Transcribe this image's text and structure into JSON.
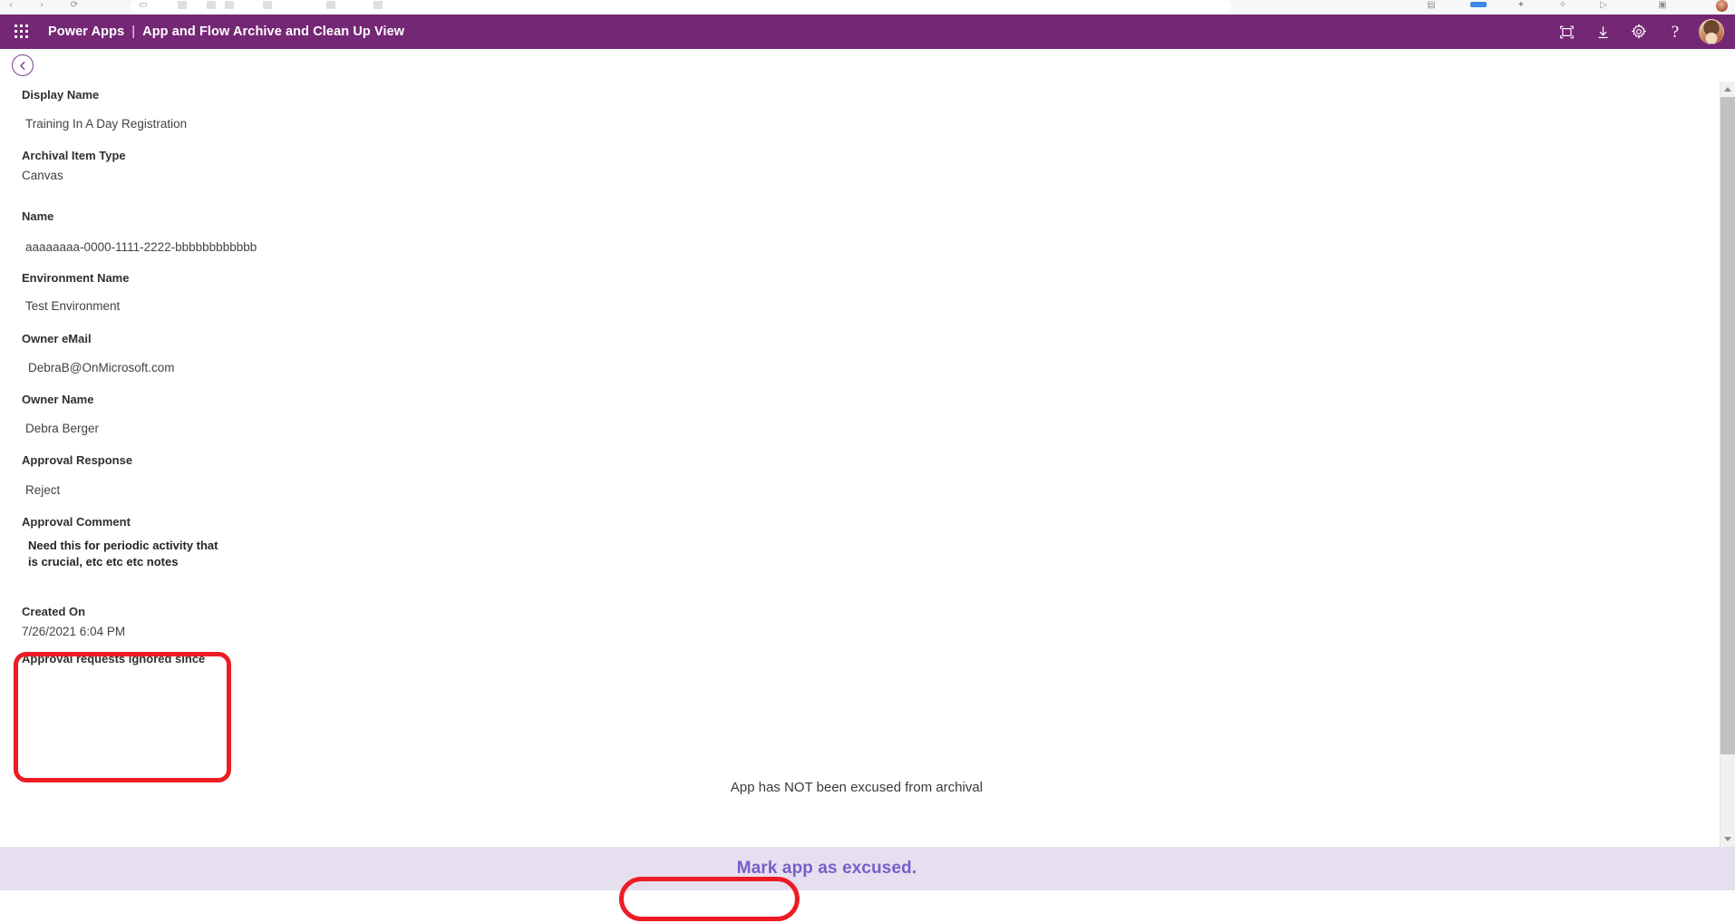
{
  "browser": {
    "url_bar_placeholder": ""
  },
  "header": {
    "waffle_icon": "app-launcher-icon",
    "brand": "Power Apps",
    "separator": "|",
    "page_title": "App and Flow Archive and Clean Up View",
    "purple": "#742774",
    "actions": [
      {
        "name": "fit-to-screen-icon",
        "tooltip": "Fit to screen"
      },
      {
        "name": "download-icon",
        "tooltip": "Download"
      },
      {
        "name": "gear-icon",
        "tooltip": "Settings"
      },
      {
        "name": "help-icon",
        "label": "?"
      }
    ],
    "avatar_name": "user-avatar"
  },
  "back_button": {
    "icon": "chevron-left-icon",
    "label": "Back"
  },
  "form": {
    "fields": [
      {
        "label": "Display Name",
        "value": "Training In A Day Registration"
      },
      {
        "label": "Archival Item Type",
        "value": "Canvas"
      },
      {
        "label": "Name",
        "value": "aaaaaaaa-0000-1111-2222-bbbbbbbbbbbb"
      },
      {
        "label": "Environment Name",
        "value": "Test Environment"
      },
      {
        "label": "Owner eMail",
        "value": "DebraB@OnMicrosoft.com"
      },
      {
        "label": "Owner Name",
        "value": "Debra Berger"
      },
      {
        "label": "Approval Response",
        "value": "Reject"
      },
      {
        "label": "Approval Comment",
        "value": "Need this for periodic activity that is crucial, etc etc etc notes"
      },
      {
        "label": "Created On",
        "value": "7/26/2021 6:04 PM"
      },
      {
        "label": "Approval requests ignored since",
        "value": ""
      }
    ]
  },
  "status": {
    "text": "App has NOT been excused from archival"
  },
  "action_bar": {
    "button_label": "Mark app as excused.",
    "background": "#e6dff0",
    "text_color": "#7a5ec9"
  },
  "scrollbar": {
    "up_arrow": "scroll-up-arrow-icon",
    "down_arrow": "scroll-down-arrow-icon"
  },
  "annotations": {
    "color": "#ee1b24",
    "items": [
      {
        "name": "approval-comment-highlight"
      },
      {
        "name": "mark-app-as-excused-highlight"
      }
    ]
  }
}
